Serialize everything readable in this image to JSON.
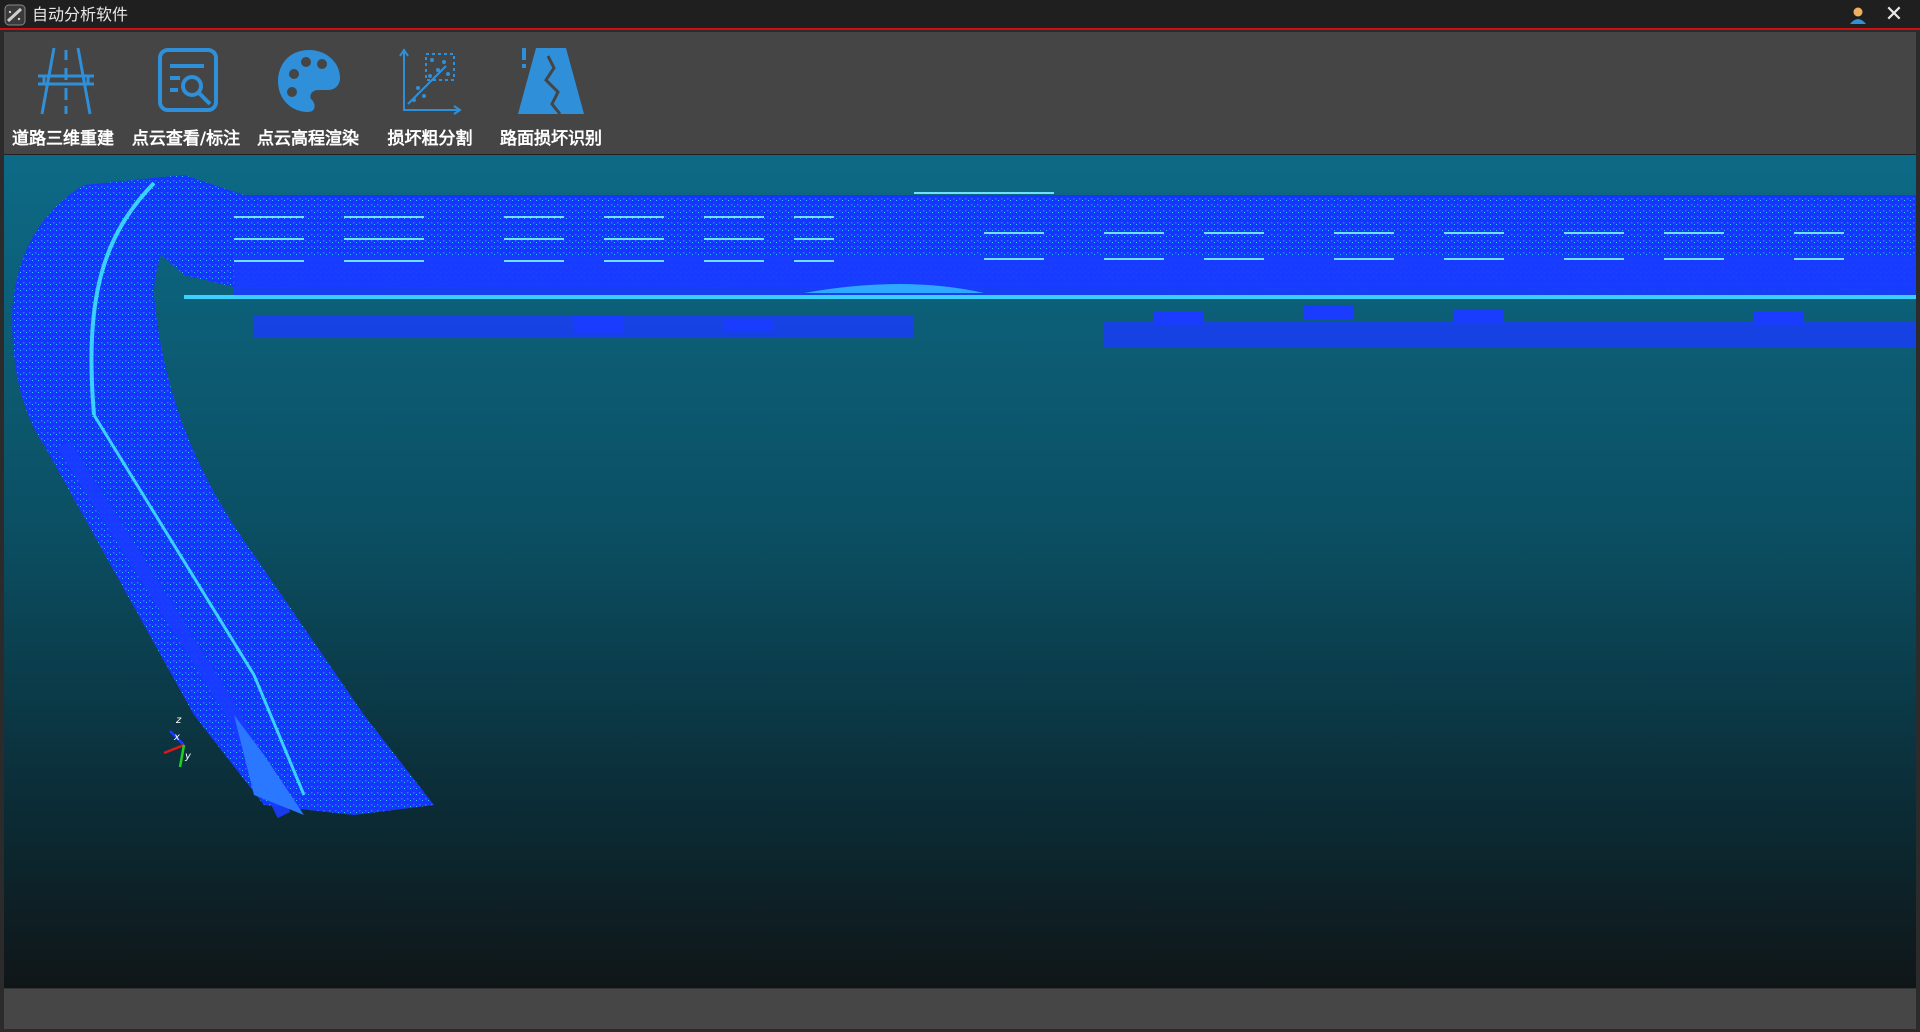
{
  "window": {
    "title": "自动分析软件",
    "accent_color": "#d01010",
    "icons": {
      "app": "pointcloud-app-icon",
      "user": "user-icon",
      "close": "close-icon"
    },
    "close_glyph": "✕"
  },
  "toolbar": {
    "icon_color": "#2f8fd8",
    "tools": [
      {
        "label": "道路三维重建",
        "icon": "road-3d-icon"
      },
      {
        "label": "点云查看/标注",
        "icon": "document-search-icon"
      },
      {
        "label": "点云高程渲染",
        "icon": "palette-icon"
      },
      {
        "label": "损坏粗分割",
        "icon": "scatter-plot-icon"
      },
      {
        "label": "路面损坏识别",
        "icon": "road-damage-icon"
      }
    ]
  },
  "viewport": {
    "content": "point-cloud-3d-view",
    "background_gradient": [
      "#0d6a86",
      "#101618"
    ],
    "point_color": "#1a3cff",
    "highlight_color": "#3ad0ff",
    "axes": {
      "z": "z",
      "x": "x",
      "y": "y"
    }
  }
}
